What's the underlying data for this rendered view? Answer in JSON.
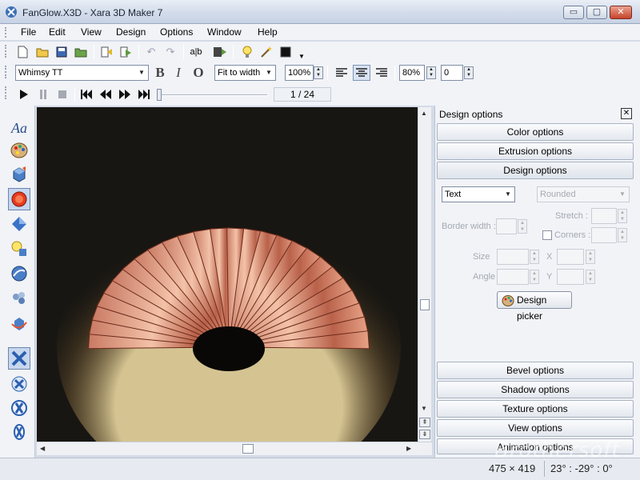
{
  "window": {
    "title": "FanGlow.X3D - Xara 3D Maker 7",
    "minimize": "▭",
    "maximize": "▢",
    "close": "✕"
  },
  "menu": [
    "File",
    "Edit",
    "View",
    "Design",
    "Options",
    "Window",
    "Help"
  ],
  "toolbar2": {
    "font": "Whimsy TT",
    "bold": "B",
    "italic": "I",
    "outline": "O",
    "zoom_mode": "Fit to width",
    "zoom_pct": "100%",
    "spacing_pct": "80%",
    "spacing_val": "0"
  },
  "playback": {
    "frame_display": "1 / 24"
  },
  "panel": {
    "title": "Design options",
    "close": "✕",
    "sections_top": [
      "Color options",
      "Extrusion options",
      "Design options"
    ],
    "sections_bottom": [
      "Bevel options",
      "Shadow options",
      "Texture options",
      "View options",
      "Animation options"
    ],
    "design": {
      "type_select": "Text",
      "style_select": "Rounded",
      "border_width_label": "Border width :",
      "stretch_label": "Stretch :",
      "corners_label": "Corners :",
      "size_label": "Size",
      "x_label": "X",
      "angle_label": "Angle",
      "y_label": "Y",
      "picker_button": "Design picker"
    }
  },
  "status": {
    "dimensions": "475 × 419",
    "rotation": "23° : -29° : 0°"
  },
  "watermark": "Brothersoft"
}
